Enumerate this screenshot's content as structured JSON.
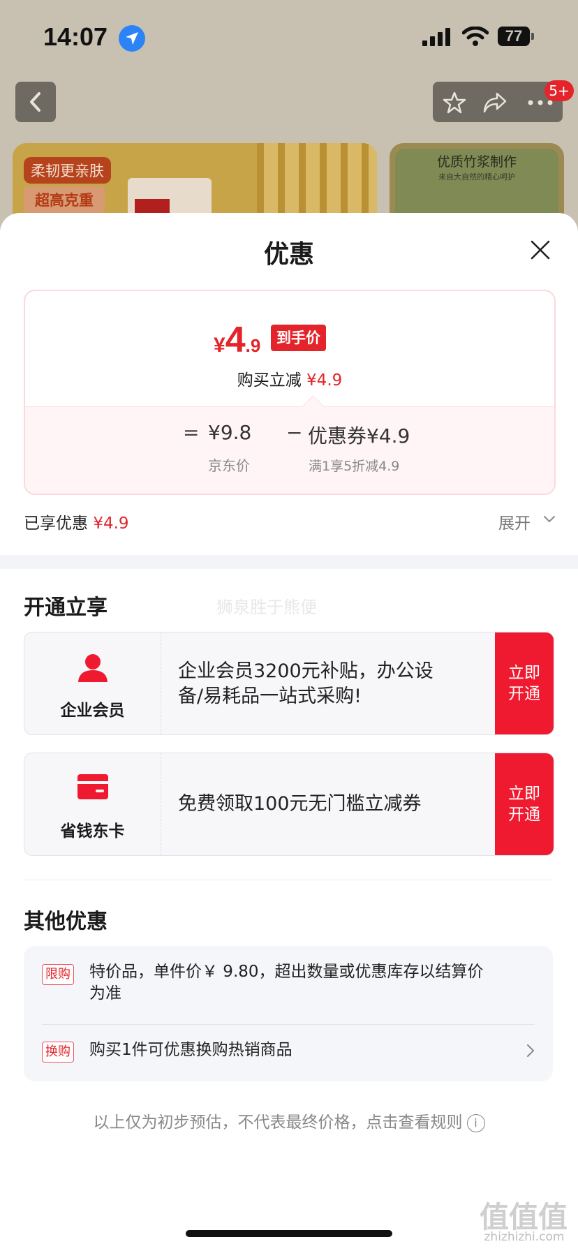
{
  "status_bar": {
    "time": "14:07",
    "battery": "77"
  },
  "nav": {
    "more_badge": "5+"
  },
  "background_page": {
    "promo_pill_1": "柔韧更亲肤",
    "promo_pill_2": "超高克重",
    "banner2_title": "优质竹浆制作",
    "banner2_sub": "来自大自然的精心呵护"
  },
  "sheet": {
    "title": "优惠",
    "price_card": {
      "currency": "¥",
      "price_int": "4",
      "price_dec": ".9",
      "final_tag": "到手价",
      "buy_reduce_label": "购买立减",
      "buy_reduce_value": "¥4.9",
      "equals": "=",
      "jd_price": "¥9.8",
      "minus": "−",
      "coupon": "优惠券¥4.9",
      "jd_price_label": "京东价",
      "coupon_rule": "满1享5折减4.9"
    },
    "enjoyed_label": "已享优惠",
    "enjoyed_value": "¥4.9",
    "expand_label": "展开",
    "open_section": {
      "title": "开通立享",
      "watermark": "狮泉胜于熊便",
      "cards": [
        {
          "name": "企业会员",
          "desc_line1": "企业会员3200元补贴，办公设",
          "desc_line2": "备/易耗品一站式采购!",
          "button_line1": "立即",
          "button_line2": "开通",
          "icon": "user-icon"
        },
        {
          "name": "省钱东卡",
          "desc_line1": "免费领取100元无门槛立减券",
          "button_line1": "立即",
          "button_line2": "开通",
          "icon": "card-icon"
        }
      ]
    },
    "other_section": {
      "title": "其他优惠",
      "items": [
        {
          "tag": "限购",
          "text_line1": "特价品，单件价￥ 9.80，超出数量或优惠库存以结算价",
          "text_line2": "为准"
        },
        {
          "tag": "换购",
          "text_line1": "购买1件可优惠换购热销商品"
        }
      ]
    },
    "footnote": "以上仅为初步预估，不代表最终价格，点击查看规则"
  },
  "corner_watermark": {
    "logo": "值值值",
    "site": "zhizhizhi.com"
  },
  "colors": {
    "accent_red": "#e3242b",
    "button_red": "#ef1a2f",
    "card_bg": "#f7f7fa"
  }
}
